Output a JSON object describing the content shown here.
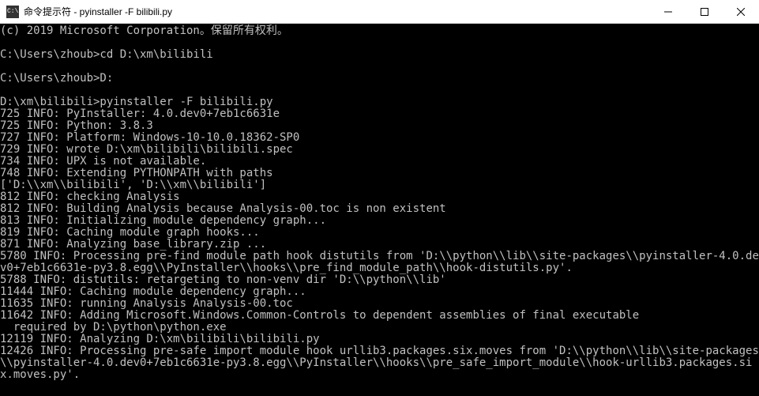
{
  "window": {
    "title": "命令提示符 - pyinstaller  -F bilibili.py"
  },
  "terminal": {
    "lines": [
      "(c) 2019 Microsoft Corporation。保留所有权利。",
      "",
      "C:\\Users\\zhoub>cd D:\\xm\\bilibili",
      "",
      "C:\\Users\\zhoub>D:",
      "",
      "D:\\xm\\bilibili>pyinstaller -F bilibili.py",
      "725 INFO: PyInstaller: 4.0.dev0+7eb1c6631e",
      "725 INFO: Python: 3.8.3",
      "727 INFO: Platform: Windows-10-10.0.18362-SP0",
      "729 INFO: wrote D:\\xm\\bilibili\\bilibili.spec",
      "734 INFO: UPX is not available.",
      "748 INFO: Extending PYTHONPATH with paths",
      "['D:\\\\xm\\\\bilibili', 'D:\\\\xm\\\\bilibili']",
      "812 INFO: checking Analysis",
      "812 INFO: Building Analysis because Analysis-00.toc is non existent",
      "813 INFO: Initializing module dependency graph...",
      "819 INFO: Caching module graph hooks...",
      "871 INFO: Analyzing base_library.zip ...",
      "5780 INFO: Processing pre-find module path hook distutils from 'D:\\\\python\\\\lib\\\\site-packages\\\\pyinstaller-4.0.dev0+7eb1c6631e-py3.8.egg\\\\PyInstaller\\\\hooks\\\\pre_find_module_path\\\\hook-distutils.py'.",
      "5788 INFO: distutils: retargeting to non-venv dir 'D:\\\\python\\\\lib'",
      "11444 INFO: Caching module dependency graph...",
      "11635 INFO: running Analysis Analysis-00.toc",
      "11642 INFO: Adding Microsoft.Windows.Common-Controls to dependent assemblies of final executable",
      "  required by D:\\python\\python.exe",
      "12119 INFO: Analyzing D:\\xm\\bilibili\\bilibili.py",
      "12426 INFO: Processing pre-safe import module hook urllib3.packages.six.moves from 'D:\\\\python\\\\lib\\\\site-packages\\\\pyinstaller-4.0.dev0+7eb1c6631e-py3.8.egg\\\\PyInstaller\\\\hooks\\\\pre_safe_import_module\\\\hook-urllib3.packages.six.moves.py'."
    ]
  }
}
